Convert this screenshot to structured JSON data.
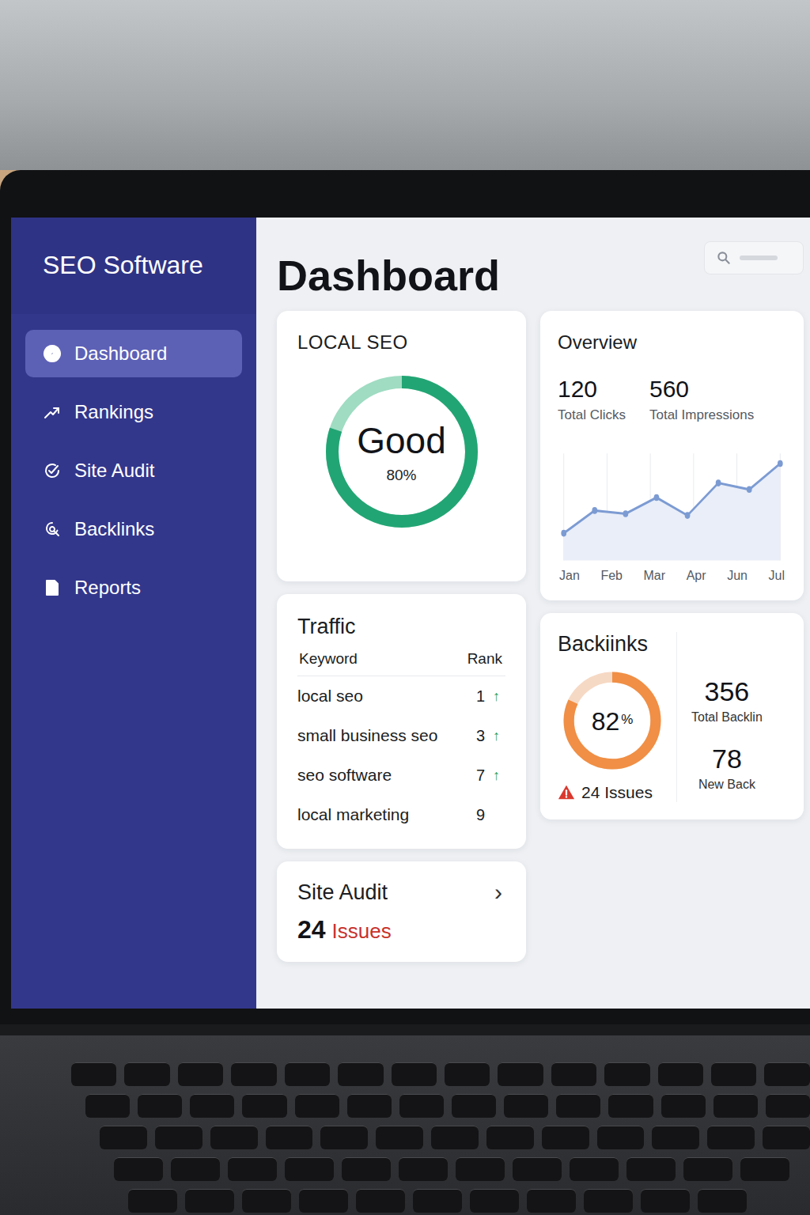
{
  "app": {
    "title": "SEO Software"
  },
  "sidebar": {
    "items": [
      {
        "label": "Dashboard",
        "selected": true
      },
      {
        "label": "Rankings",
        "selected": false
      },
      {
        "label": "Site Audit",
        "selected": false
      },
      {
        "label": "Backlinks",
        "selected": false
      },
      {
        "label": "Reports",
        "selected": false
      }
    ]
  },
  "page": {
    "title": "Dashboard"
  },
  "local_seo": {
    "title": "LOCAL SEO",
    "status": "Good",
    "percent": "80%",
    "level": 0.8
  },
  "overview": {
    "title": "Overview",
    "stats": [
      {
        "value": "120",
        "label": "Total Clicks"
      },
      {
        "value": "560",
        "label": "Total Impressions"
      }
    ],
    "chart": {
      "series": [
        {
          "values": [
            12,
            26,
            24,
            34,
            23,
            43,
            39,
            55
          ]
        }
      ],
      "x_ticks": [
        "Jan",
        "Feb",
        "Mar",
        "Apr",
        "Jun",
        "Jul"
      ]
    }
  },
  "traffic": {
    "title": "Traffic",
    "columns": [
      "Keyword",
      "Rank"
    ],
    "trend_icon": "↑",
    "rows": [
      {
        "keyword": "local seo",
        "rank": "1",
        "trend_up": true
      },
      {
        "keyword": "small business seo",
        "rank": "3",
        "trend_up": true
      },
      {
        "keyword": "seo software",
        "rank": "7",
        "trend_up": true
      },
      {
        "keyword": "local marketing",
        "rank": "9",
        "trend_up": false
      }
    ]
  },
  "backlinks": {
    "title": "Backiinks",
    "score": "82",
    "unit": "%",
    "level": 0.82,
    "issues": "24 Issues",
    "stats": [
      {
        "value": "356",
        "label": "Total Backlin"
      },
      {
        "value": "78",
        "label": "New Back"
      }
    ]
  },
  "site_audit": {
    "title": "Site Audit",
    "count": "24",
    "label": "Issues",
    "chevron": "›"
  }
}
